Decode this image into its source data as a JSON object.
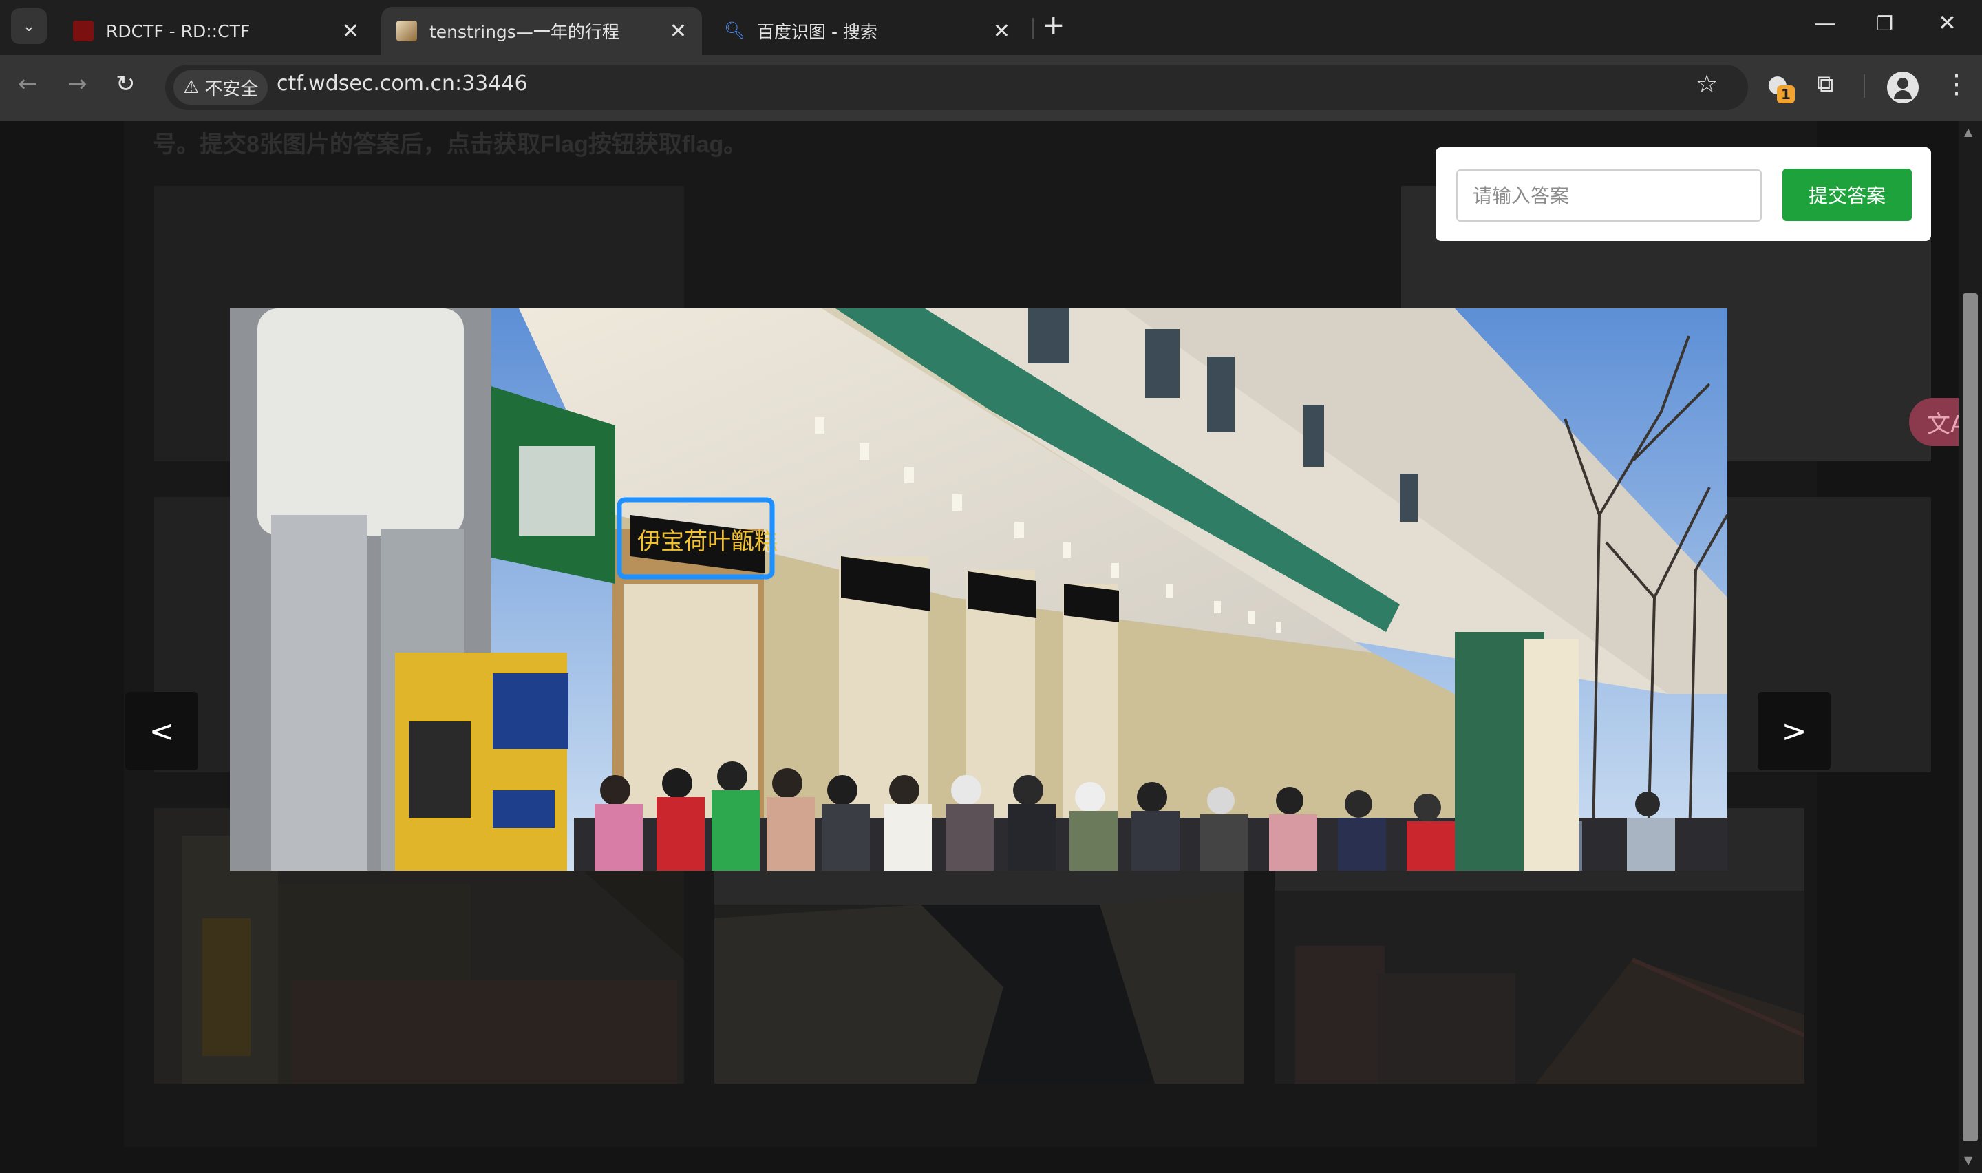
{
  "browser": {
    "tabs": [
      {
        "title": "RDCTF - RD::CTF",
        "favicon": "rdctf-logo-icon"
      },
      {
        "title": "tenstrings—一年的行程",
        "favicon": "photo-icon"
      },
      {
        "title": "百度识图 - 搜索",
        "favicon": "search-icon"
      }
    ],
    "new_tab_label": "+",
    "security_label": "不安全",
    "url": "ctf.wdsec.com.cn:33446",
    "extension_badge": "1"
  },
  "page": {
    "instruction_text": "号。提交8张图片的答案后，点击获取Flag按钮获取flag。",
    "prev_label": "<",
    "next_label": ">",
    "answer_placeholder": "请输入答案",
    "submit_label": "提交答案",
    "translate_label": "文A",
    "photo_sign_text": "伊宝荷叶甑糕"
  },
  "colors": {
    "submit_button": "#1ea23b",
    "highlight_box": "#1e90ff",
    "sign_bg": "#111111",
    "sign_text": "#f2c230"
  }
}
